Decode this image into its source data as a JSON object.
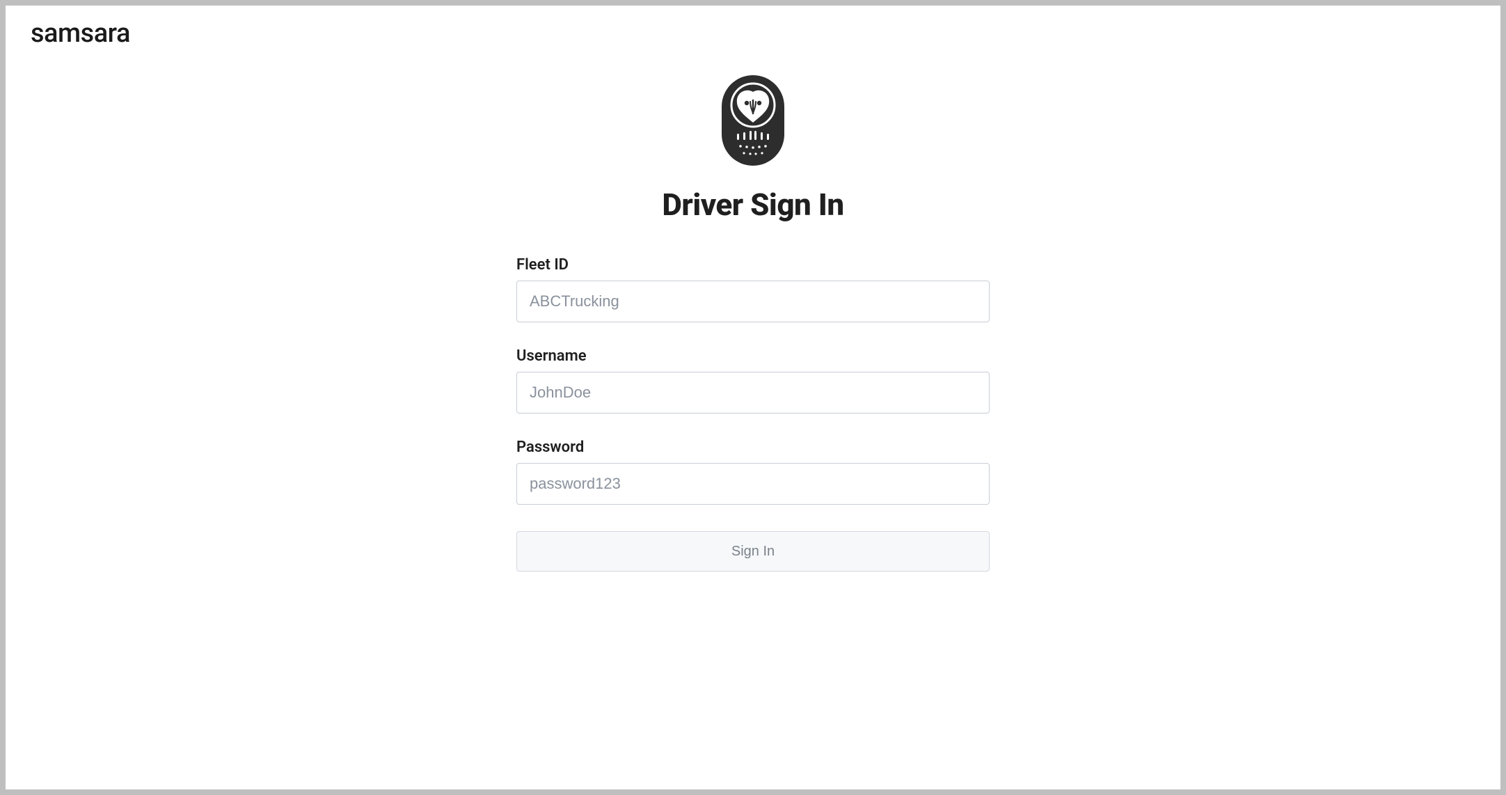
{
  "brand": {
    "wordmark": "samsara"
  },
  "page": {
    "title": "Driver Sign In"
  },
  "form": {
    "fleet_id": {
      "label": "Fleet ID",
      "placeholder": "ABCTrucking",
      "value": ""
    },
    "username": {
      "label": "Username",
      "placeholder": "JohnDoe",
      "value": ""
    },
    "password": {
      "label": "Password",
      "placeholder": "password123",
      "value": ""
    },
    "submit_label": "Sign In"
  }
}
